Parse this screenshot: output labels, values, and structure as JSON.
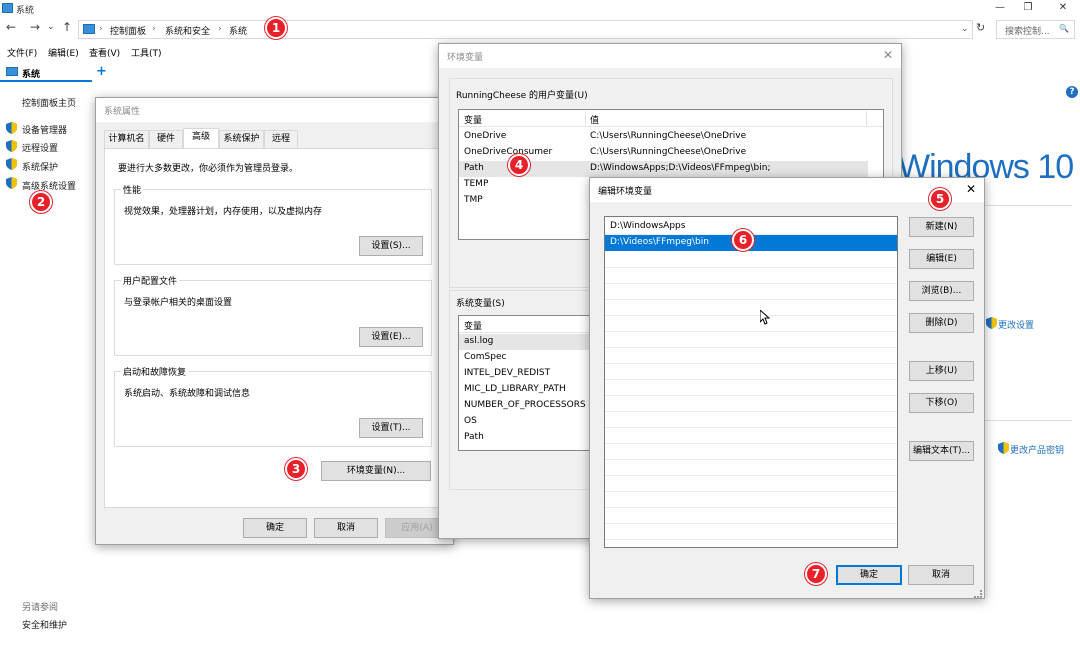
{
  "window": {
    "title": "系统"
  },
  "window_controls": {
    "minimize": "—",
    "maximize": "❐",
    "close": "✕"
  },
  "nav": {
    "back": "←",
    "forward": "→",
    "up": "↑",
    "refresh": "↻",
    "dropdown": "⌄"
  },
  "breadcrumb": [
    "控制面板",
    "系统和安全",
    "系统"
  ],
  "breadcrumb_sep": "›",
  "search": {
    "placeholder": "搜索控制...",
    "icon": "🔍"
  },
  "menu": [
    "文件(F)",
    "编辑(E)",
    "查看(V)",
    "工具(T)"
  ],
  "tab": {
    "label": "系统",
    "add": "+"
  },
  "help_icon": "?",
  "sidebar": {
    "home": "控制面板主页",
    "items": [
      "设备管理器",
      "远程设置",
      "系统保护",
      "高级系统设置"
    ],
    "see_also": "另请参阅",
    "see_also_link": "安全和维护"
  },
  "background": {
    "brand": "Windows 10",
    "change_settings": "更改设置",
    "change_key": "更改产品密钥"
  },
  "sysprops": {
    "title": "系统属性",
    "tabs": [
      "计算机名",
      "硬件",
      "高级",
      "系统保护",
      "远程"
    ],
    "note": "要进行大多数更改，你必须作为管理员登录。",
    "perf": {
      "label": "性能",
      "desc": "视觉效果，处理器计划，内存使用，以及虚拟内存",
      "btn": "设置(S)..."
    },
    "profile": {
      "label": "用户配置文件",
      "desc": "与登录帐户相关的桌面设置",
      "btn": "设置(E)..."
    },
    "startup": {
      "label": "启动和故障恢复",
      "desc": "系统启动、系统故障和调试信息",
      "btn": "设置(T)..."
    },
    "env_btn": "环境变量(N)...",
    "ok": "确定",
    "cancel": "取消",
    "apply": "应用(A)"
  },
  "envvars": {
    "title": "环境变量",
    "close": "✕",
    "user_label": "RunningCheese 的用户变量(U)",
    "user_headers": [
      "变量",
      "值"
    ],
    "user_rows": [
      [
        "OneDrive",
        "C:\\Users\\RunningCheese\\OneDrive"
      ],
      [
        "OneDriveConsumer",
        "C:\\Users\\RunningCheese\\OneDrive"
      ],
      [
        "Path",
        "D:\\WindowsApps;D:\\Videos\\FFmpeg\\bin;"
      ],
      [
        "TEMP",
        ""
      ],
      [
        "TMP",
        ""
      ]
    ],
    "sys_label": "系统变量(S)",
    "sys_header": "变量",
    "sys_rows": [
      "asl.log",
      "ComSpec",
      "INTEL_DEV_REDIST",
      "MIC_LD_LIBRARY_PATH",
      "NUMBER_OF_PROCESSORS",
      "OS",
      "Path"
    ]
  },
  "editenv": {
    "title": "编辑环境变量",
    "close": "✕",
    "items": [
      "D:\\WindowsApps",
      "D:\\Videos\\FFmpeg\\bin"
    ],
    "buttons": [
      "新建(N)",
      "编辑(E)",
      "浏览(B)...",
      "删除(D)",
      "上移(U)",
      "下移(O)",
      "编辑文本(T)..."
    ],
    "ok": "确定",
    "cancel": "取消"
  },
  "markers": [
    "1",
    "2",
    "3",
    "4",
    "5",
    "6",
    "7"
  ],
  "colors": {
    "marker": "#e8202a",
    "selection": "#0078d7",
    "brand": "#1e6fc0"
  }
}
